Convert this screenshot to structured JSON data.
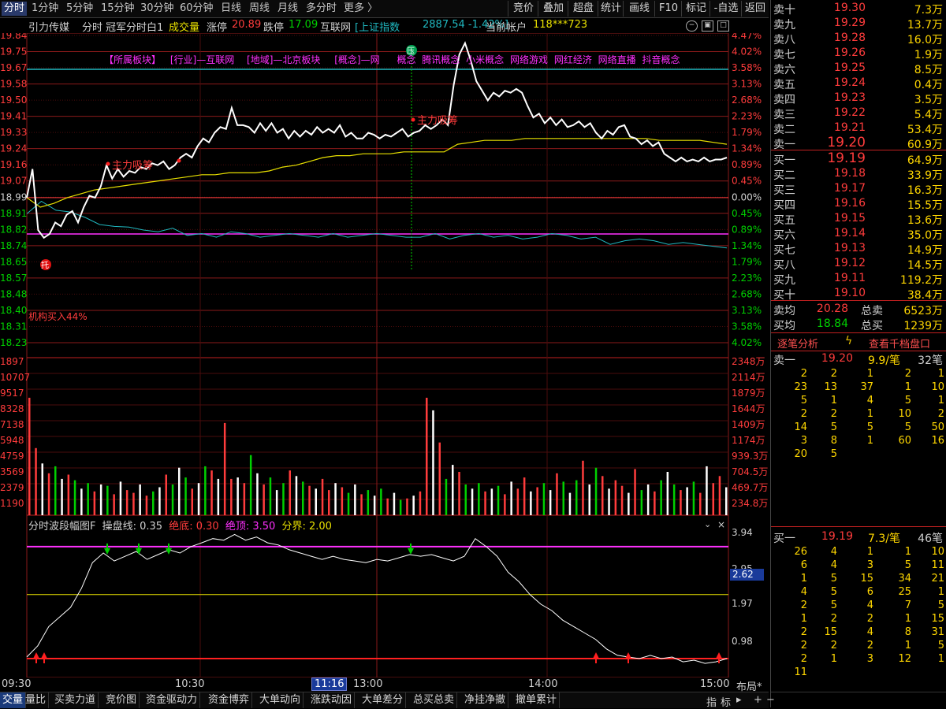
{
  "toolbar": {
    "periods": [
      "分时",
      "1分钟",
      "5分钟",
      "15分钟",
      "30分钟",
      "60分钟",
      "日线",
      "周线",
      "月线",
      "多分时",
      "更多 〉"
    ],
    "buttons": [
      "竞价",
      "叠加",
      "超盘",
      "统计",
      "画线",
      "F10",
      "标记",
      "-自选",
      "返回"
    ]
  },
  "info": {
    "stock_name": "引力传媒",
    "mode": "分时",
    "indicator": "冠军分时白1",
    "vol_label": "成交量",
    "up_limit_label": "涨停",
    "up_limit": "20.89",
    "down_limit_label": "跌停",
    "down_limit": "17.09",
    "sector": "互联网",
    "index_label": "[上证指数",
    "index_value": "2887.54 -1.42%]",
    "account_label": "当前帐户",
    "account": "118***723"
  },
  "chart_data": {
    "type": "line",
    "price_axis": [
      "19.84",
      "19.75",
      "19.67",
      "19.58",
      "19.50",
      "19.41",
      "19.33",
      "19.24",
      "19.16",
      "19.07",
      "18.99",
      "18.91",
      "18.82",
      "18.74",
      "18.65",
      "18.57",
      "18.48",
      "18.40",
      "18.31",
      "18.23"
    ],
    "pct_axis": [
      "4.47%",
      "4.02%",
      "3.58%",
      "3.13%",
      "2.68%",
      "2.23%",
      "1.79%",
      "1.34%",
      "0.89%",
      "0.45%",
      "0.00%",
      "0.45%",
      "0.89%",
      "1.34%",
      "1.79%",
      "2.23%",
      "2.68%",
      "3.13%",
      "3.58%",
      "4.02%"
    ],
    "prev_close": 18.99,
    "price_ylim": [
      18.23,
      19.84
    ],
    "price_series": [
      18.99,
      19.14,
      18.82,
      18.78,
      18.8,
      18.86,
      18.84,
      18.9,
      18.92,
      18.86,
      18.94,
      19.0,
      18.99,
      19.05,
      19.16,
      19.09,
      19.14,
      19.1,
      19.13,
      19.12,
      19.15,
      19.14,
      19.17,
      19.16,
      19.18,
      19.14,
      19.16,
      19.2,
      19.22,
      19.2,
      19.26,
      19.3,
      19.28,
      19.33,
      19.36,
      19.35,
      19.46,
      19.37,
      19.37,
      19.36,
      19.33,
      19.38,
      19.34,
      19.38,
      19.33,
      19.35,
      19.3,
      19.34,
      19.31,
      19.34,
      19.32,
      19.36,
      19.33,
      19.35,
      19.33,
      19.37,
      19.31,
      19.33,
      19.3,
      19.3,
      19.33,
      19.32,
      19.3,
      19.32,
      19.31,
      19.33,
      19.35,
      19.31,
      19.33,
      19.34,
      19.37,
      19.35,
      19.37,
      19.4,
      19.37,
      19.58,
      19.74,
      19.8,
      19.71,
      19.6,
      19.55,
      19.5,
      19.54,
      19.52,
      19.55,
      19.54,
      19.56,
      19.54,
      19.47,
      19.41,
      19.43,
      19.38,
      19.41,
      19.37,
      19.4,
      19.36,
      19.37,
      19.39,
      19.36,
      19.38,
      19.33,
      19.3,
      19.34,
      19.32,
      19.36,
      19.37,
      19.31,
      19.3,
      19.27,
      19.29,
      19.26,
      19.28,
      19.22,
      19.2,
      19.18,
      19.2,
      19.18,
      19.19,
      19.18,
      19.2,
      19.18,
      19.19,
      19.19,
      19.2
    ],
    "avg_series": [
      18.99,
      18.94,
      18.96,
      18.99,
      19.01,
      19.03,
      19.04,
      19.05,
      19.06,
      19.07,
      19.08,
      19.09,
      19.1,
      19.11,
      19.11,
      19.12,
      19.12,
      19.12,
      19.13,
      19.15,
      19.16,
      19.18,
      19.2,
      19.21,
      19.21,
      19.22,
      19.22,
      19.22,
      19.23,
      19.23,
      19.23,
      19.23,
      19.27,
      19.28,
      19.29,
      19.29,
      19.29,
      19.3,
      19.3,
      19.3,
      19.3,
      19.3,
      19.3,
      19.3,
      19.3,
      19.3,
      19.3,
      19.29,
      19.29,
      19.29,
      19.29,
      19.28,
      19.27
    ],
    "index_pct": [
      0.45,
      0.1,
      0.35,
      0.4,
      0.55,
      0.75,
      0.8,
      0.82,
      0.9,
      0.95,
      0.85,
      1.05,
      1.0,
      1.1,
      0.95,
      1.0,
      1.1,
      1.05,
      1.0,
      1.05,
      1.1,
      1.0,
      1.1,
      1.05,
      1.0,
      1.05,
      1.1,
      1.1,
      1.0,
      1.15,
      1.05,
      1.0,
      1.1,
      1.05,
      1.15,
      1.1,
      1.0,
      1.05,
      1.15,
      1.1,
      1.3,
      1.2,
      1.15,
      1.2,
      1.3,
      1.25,
      1.3,
      1.35,
      1.4
    ],
    "vol_axis": [
      "1897",
      "10707",
      "9517",
      "8328",
      "7138",
      "5948",
      "4759",
      "3569",
      "2379",
      "1190"
    ],
    "vol_axis_right": [
      "2348万",
      "2114万",
      "1879万",
      "1644万",
      "1409万",
      "1174万",
      "939.3万",
      "704.5万",
      "469.7万",
      "234.8万"
    ],
    "volumes": [
      8400,
      4800,
      3700,
      3000,
      3500,
      2600,
      2900,
      2500,
      1900,
      2300,
      1700,
      2200,
      2100,
      1500,
      2400,
      1800,
      1600,
      2200,
      1400,
      1700,
      2000,
      2900,
      2200,
      3400,
      2700,
      1900,
      2300,
      3500,
      3200,
      2600,
      6600,
      2600,
      2700,
      2300,
      4300,
      3000,
      2200,
      2700,
      1800,
      2300,
      3200,
      2800,
      2400,
      2100,
      1900,
      2600,
      1800,
      2300,
      2000,
      1600,
      2200,
      1500,
      1800,
      1400,
      1900,
      1200,
      1600,
      1100,
      1200,
      1400,
      1700,
      8400,
      7500,
      5200,
      2600,
      3600,
      3100,
      2200,
      1900,
      2300,
      1700,
      1900,
      2100,
      1500,
      2400,
      1900,
      2700,
      1700,
      2000,
      2300,
      1800,
      3000,
      2400,
      1600,
      2500,
      3900,
      2200,
      3400,
      2800,
      1900,
      2500,
      2100,
      1600,
      3300,
      1800,
      2200,
      1700,
      2500,
      3100,
      2200,
      1800,
      2000,
      2400,
      1600,
      3500,
      2300,
      2800,
      2000
    ],
    "amp_title": "分时波段幅图F",
    "amp_params": [
      "操盘线: 0.35",
      "绝底: 0.30",
      "绝顶: 3.50",
      "分界: 2.00"
    ],
    "amp_axis": [
      "3.94",
      "2.95",
      "1.97",
      "0.98"
    ],
    "amp_current": "2.62",
    "amp_series": [
      0.05,
      0.4,
      1.0,
      1.3,
      1.6,
      2.2,
      3.0,
      3.3,
      3.05,
      3.2,
      3.35,
      3.1,
      3.25,
      3.4,
      3.3,
      3.5,
      3.62,
      3.75,
      3.7,
      3.88,
      3.7,
      3.8,
      3.62,
      3.55,
      3.4,
      3.3,
      3.2,
      3.1,
      3.2,
      3.1,
      3.05,
      3.0,
      3.1,
      3.05,
      3.15,
      3.25,
      3.2,
      3.25,
      3.15,
      3.05,
      3.2,
      3.75,
      3.5,
      3.2,
      2.7,
      2.4,
      2.0,
      1.7,
      1.5,
      1.2,
      1.0,
      0.8,
      0.6,
      0.3,
      0.1,
      0.05,
      0.0,
      0.1,
      0.0,
      0.05,
      -0.1,
      -0.05,
      -0.15,
      -0.1,
      0.0
    ],
    "time_labels": [
      "09:30",
      "10:30",
      "11:16",
      "13:00",
      "14:00",
      "15:00"
    ],
    "annotations": {
      "sector_tags": [
        "【所属板块】",
        "[行业]—互联网",
        "[地域]—北京板块",
        "[概念]—网",
        "概念",
        "腾讯概念",
        "小米概念",
        "网络游戏",
        "网红经济",
        "网络直播",
        "抖音概念"
      ],
      "main_absorb_1": "主力吸筹",
      "main_absorb_2": "主力吸筹",
      "institution": "机构买入44%",
      "pressure": "压",
      "support": "托"
    }
  },
  "order_book": {
    "asks": [
      {
        "label": "卖十",
        "price": "19.30",
        "vol": "7.3万"
      },
      {
        "label": "卖九",
        "price": "19.29",
        "vol": "13.7万"
      },
      {
        "label": "卖八",
        "price": "19.28",
        "vol": "16.0万"
      },
      {
        "label": "卖七",
        "price": "19.26",
        "vol": "1.9万"
      },
      {
        "label": "卖六",
        "price": "19.25",
        "vol": "8.5万"
      },
      {
        "label": "卖五",
        "price": "19.24",
        "vol": "0.4万"
      },
      {
        "label": "卖四",
        "price": "19.23",
        "vol": "3.5万"
      },
      {
        "label": "卖三",
        "price": "19.22",
        "vol": "5.4万"
      },
      {
        "label": "卖二",
        "price": "19.21",
        "vol": "53.4万"
      },
      {
        "label": "卖一",
        "price": "19.20",
        "vol": "60.9万"
      }
    ],
    "bids": [
      {
        "label": "买一",
        "price": "19.19",
        "vol": "64.9万"
      },
      {
        "label": "买二",
        "price": "19.18",
        "vol": "33.9万"
      },
      {
        "label": "买三",
        "price": "19.17",
        "vol": "16.3万"
      },
      {
        "label": "买四",
        "price": "19.16",
        "vol": "15.5万"
      },
      {
        "label": "买五",
        "price": "19.15",
        "vol": "13.6万"
      },
      {
        "label": "买六",
        "price": "19.14",
        "vol": "35.0万"
      },
      {
        "label": "买七",
        "price": "19.13",
        "vol": "14.9万"
      },
      {
        "label": "买八",
        "price": "19.12",
        "vol": "14.5万"
      },
      {
        "label": "买九",
        "price": "19.11",
        "vol": "119.2万"
      },
      {
        "label": "买十",
        "price": "19.10",
        "vol": "38.4万"
      }
    ],
    "ask_avg_label": "卖均",
    "ask_avg": "20.28",
    "total_sell_label": "总卖",
    "total_sell": "6523万",
    "bid_avg_label": "买均",
    "bid_avg": "18.84",
    "total_buy_label": "总买",
    "total_buy": "1239万"
  },
  "tick_panel": {
    "tab1": "逐笔分析",
    "tab2": "查看千档盘口",
    "sell1_label": "卖一",
    "sell1_price": "19.20",
    "sell1_per": "9.9/笔",
    "sell1_count": "32笔",
    "sell_rows": [
      [
        "2",
        "2",
        "1",
        "2",
        "1"
      ],
      [
        "23",
        "13",
        "37",
        "1",
        "10"
      ],
      [
        "5",
        "1",
        "4",
        "5",
        "1"
      ],
      [
        "2",
        "2",
        "1",
        "10",
        "2"
      ],
      [
        "14",
        "5",
        "5",
        "5",
        "50"
      ],
      [
        "3",
        "8",
        "1",
        "60",
        "16"
      ],
      [
        "20",
        "5",
        "",
        "",
        ""
      ]
    ],
    "buy1_label": "买一",
    "buy1_price": "19.19",
    "buy1_per": "7.3/笔",
    "buy1_count": "46笔",
    "buy_rows": [
      [
        "26",
        "4",
        "1",
        "1",
        "10"
      ],
      [
        "6",
        "4",
        "3",
        "5",
        "11"
      ],
      [
        "1",
        "5",
        "15",
        "34",
        "21"
      ],
      [
        "4",
        "5",
        "6",
        "25",
        "1"
      ],
      [
        "2",
        "5",
        "4",
        "7",
        "5"
      ],
      [
        "1",
        "2",
        "2",
        "1",
        "15"
      ],
      [
        "2",
        "15",
        "4",
        "8",
        "31"
      ],
      [
        "2",
        "2",
        "2",
        "1",
        "5"
      ],
      [
        "2",
        "1",
        "3",
        "12",
        "1"
      ],
      [
        "11",
        "",
        "",
        "",
        ""
      ]
    ]
  },
  "bottom_tabs": [
    "交量",
    "量比",
    "买卖力道",
    "竞价图",
    "资金驱动力",
    "资金博弈",
    "大单动向",
    "涨跌动因",
    "大单差分",
    "总买总卖",
    "净挂净撤",
    "撤单累计"
  ],
  "bottom_right": [
    "指",
    "标",
    "▸",
    "布局*",
    "+",
    "−"
  ],
  "colors": {
    "up": "#ff3c3c",
    "down": "#00d000",
    "price": "#ffffff",
    "avg": "#e8e000",
    "index": "#20b8c0",
    "magenta": "#ff30ff",
    "grid": "#8a1a1a"
  }
}
